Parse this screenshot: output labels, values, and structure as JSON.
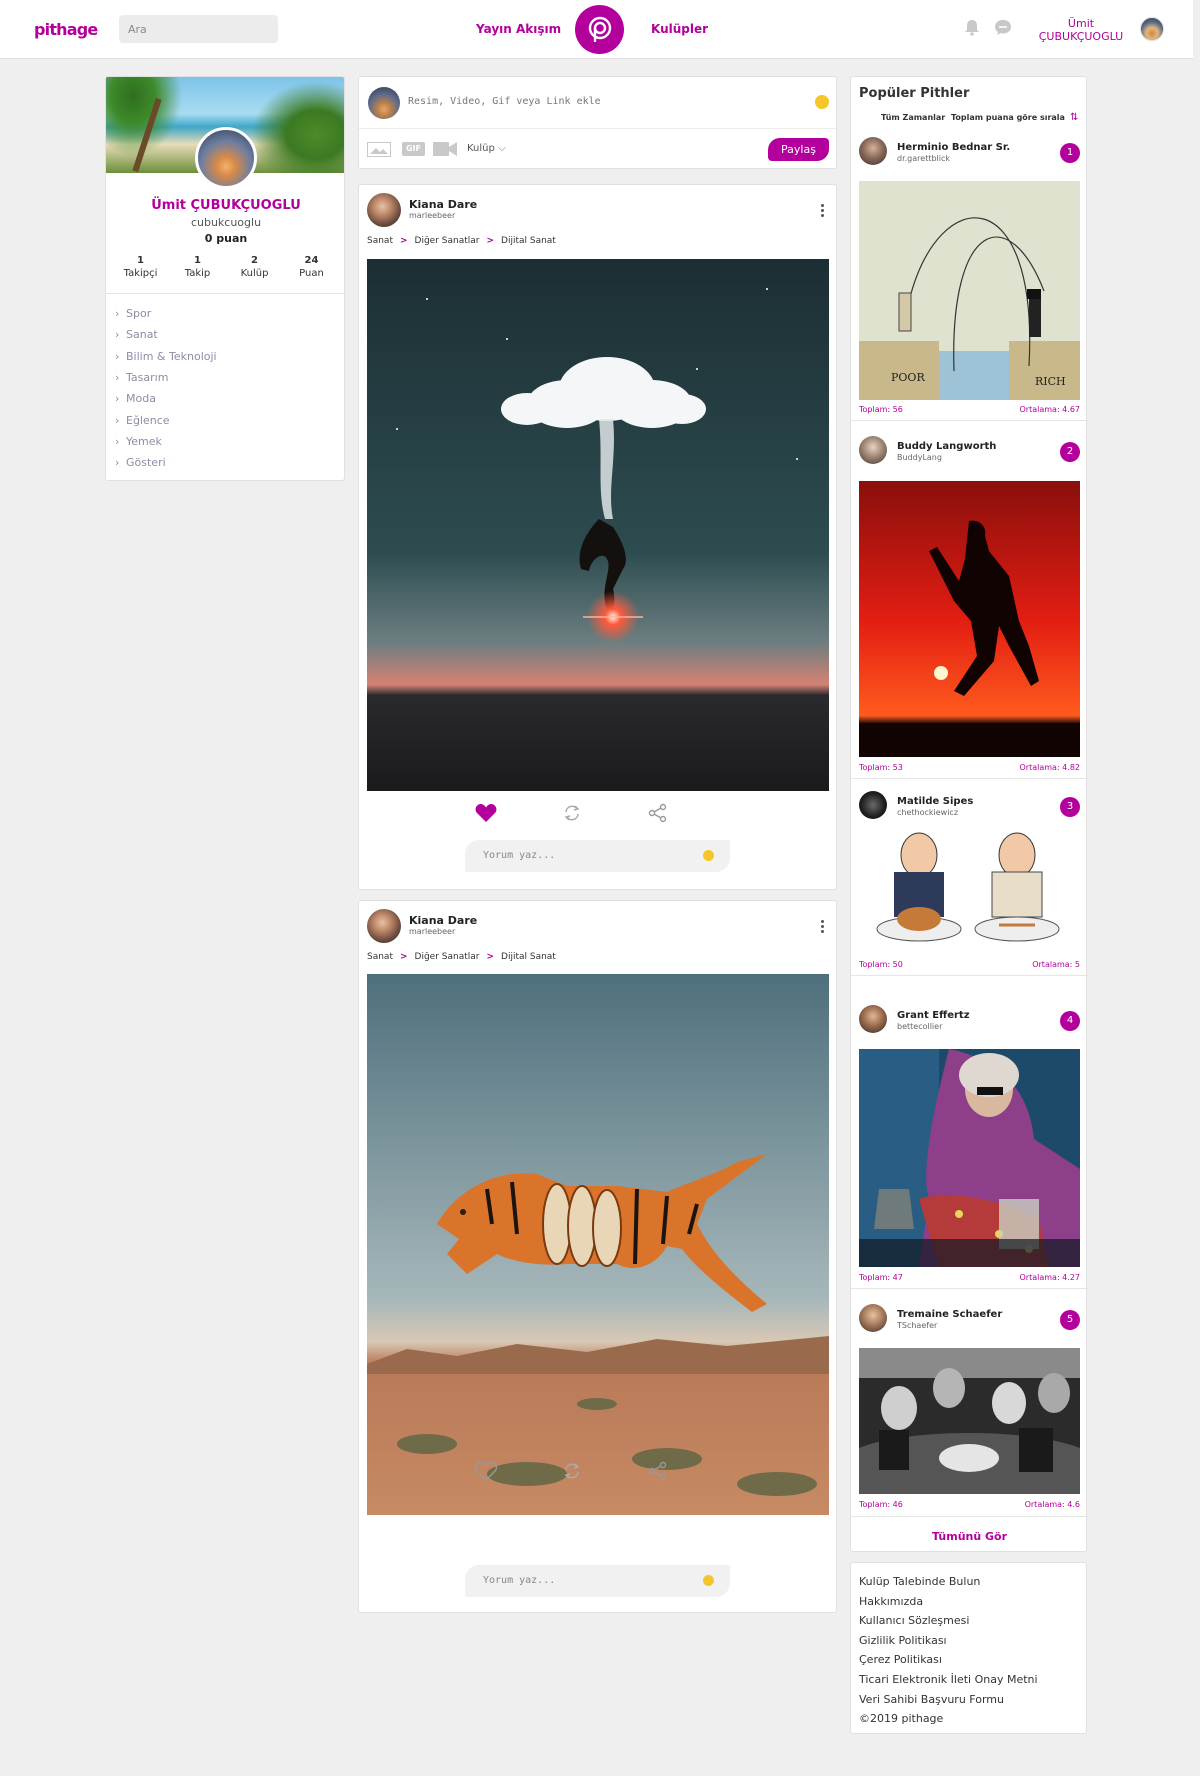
{
  "header": {
    "logo": "pithage",
    "search_placeholder": "Ara",
    "nav_feed": "Yayın Akışım",
    "nav_clubs": "Kulüpler",
    "username_line1": "Ümit",
    "username_line2": "ÇUBUKÇUOGLU",
    "icons": [
      "bell-icon",
      "chat-icon"
    ]
  },
  "profile": {
    "name": "Ümit ÇUBUKÇUOGLU",
    "handle": "cubukcuoglu",
    "points": "0 puan",
    "stats": [
      {
        "num": "1",
        "label": "Takipçi"
      },
      {
        "num": "1",
        "label": "Takip"
      },
      {
        "num": "2",
        "label": "Kulüp"
      },
      {
        "num": "24",
        "label": "Puan"
      }
    ],
    "categories": [
      "Spor",
      "Sanat",
      "Bilim & Teknoloji",
      "Tasarım",
      "Moda",
      "Eğlence",
      "Yemek",
      "Gösteri"
    ]
  },
  "composer": {
    "placeholder": "Resim, Video, Gif veya Link ekle",
    "gif_label": "GIF",
    "club_label": "Kulüp",
    "share_label": "Paylaş"
  },
  "posts": [
    {
      "author": "Kiana Dare",
      "handle": "marleebeer",
      "breadcrumb": [
        "Sanat",
        "Diğer Sanatlar",
        "Dijital Sanat"
      ],
      "liked": true,
      "comment_placeholder": "Yorum yaz..."
    },
    {
      "author": "Kiana Dare",
      "handle": "marleebeer",
      "breadcrumb": [
        "Sanat",
        "Diğer Sanatlar",
        "Dijital Sanat"
      ],
      "liked": false,
      "comment_placeholder": "Yorum yaz..."
    }
  ],
  "popular": {
    "title": "Popüler Pithler",
    "filter_time": "Tüm Zamanlar",
    "filter_sort": "Toplam puana göre sırala",
    "items": [
      {
        "rank": "1",
        "name": "Herminio Bednar Sr.",
        "handle": "dr.garettblick",
        "total": "Toplam: 56",
        "avg": "Ortalama: 4.67",
        "image_labels": [
          "POOR",
          "RICH"
        ]
      },
      {
        "rank": "2",
        "name": "Buddy Langworth",
        "handle": "BuddyLang",
        "total": "Toplam: 53",
        "avg": "Ortalama: 4.82"
      },
      {
        "rank": "3",
        "name": "Matilde Sipes",
        "handle": "chethockiewicz",
        "total": "Toplam: 50",
        "avg": "Ortalama: 5"
      },
      {
        "rank": "4",
        "name": "Grant Effertz",
        "handle": "bettecollier",
        "total": "Toplam: 47",
        "avg": "Ortalama: 4.27"
      },
      {
        "rank": "5",
        "name": "Tremaine Schaefer",
        "handle": "TSchaefer",
        "total": "Toplam: 46",
        "avg": "Ortalama: 4.6"
      }
    ],
    "see_all": "Tümünü Gör"
  },
  "footer_links": [
    "Kulüp Talebinde Bulun",
    "Hakkımızda",
    "Kullanıcı Sözleşmesi",
    "Gizlilik Politikası",
    "Çerez Politikası",
    "Ticari Elektronik İleti Onay Metni",
    "Veri Sahibi Başvuru Formu",
    "©2019 pithage"
  ],
  "colors": {
    "accent": "#b3009c",
    "background": "#efefef"
  }
}
